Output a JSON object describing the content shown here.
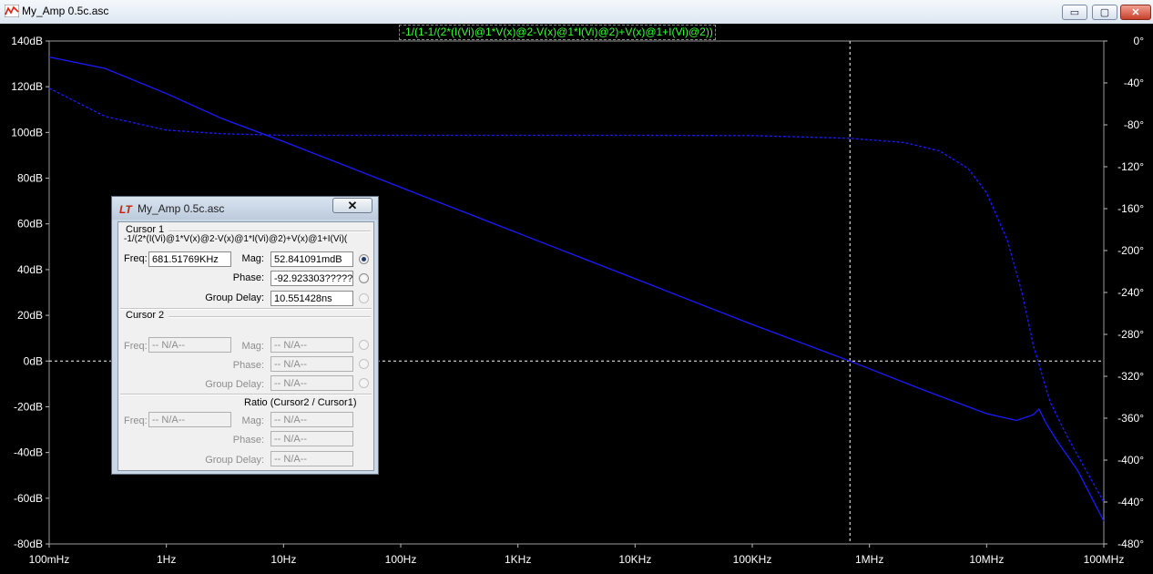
{
  "window": {
    "title": "My_Amp 0.5c.asc",
    "controls": {
      "minimize": "▭",
      "maximize": "▢",
      "close": "✕"
    }
  },
  "plot": {
    "trace_label": "-1/(1-1/(2*(I(Vi)@1*V(x)@2-V(x)@1*I(Vi)@2)+V(x)@1+I(Vi)@2))",
    "colors": {
      "background": "#000000",
      "trace": "#1a1aff",
      "axis_text": "#ffffff",
      "grid": "#ffffff",
      "label": "#33ff33"
    }
  },
  "chart_data": {
    "type": "line",
    "title": "",
    "x_scale": "log",
    "xlim": [
      0.1,
      100000000
    ],
    "x_ticks": [
      "100mHz",
      "1Hz",
      "10Hz",
      "100Hz",
      "1KHz",
      "10KHz",
      "100KHz",
      "1MHz",
      "10MHz",
      "100MHz"
    ],
    "ylim_left": [
      -80,
      140
    ],
    "y_ticks_left": [
      "140dB",
      "120dB",
      "100dB",
      "80dB",
      "60dB",
      "40dB",
      "20dB",
      "0dB",
      "-20dB",
      "-40dB",
      "-60dB",
      "-80dB"
    ],
    "ylim_right": [
      -480,
      0
    ],
    "y_ticks_right": [
      "0°",
      "-40°",
      "-80°",
      "-120°",
      "-160°",
      "-200°",
      "-240°",
      "-280°",
      "-320°",
      "-360°",
      "-400°",
      "-440°",
      "-480°"
    ],
    "series": [
      {
        "style": "solid",
        "axis": "left",
        "x": [
          0.1,
          0.3,
          1,
          3,
          10,
          100,
          1000,
          10000,
          100000,
          681517.69,
          3000000,
          10000000,
          18000000,
          25000000,
          28000000,
          32000000,
          40000000,
          60000000,
          100000000
        ],
        "y": [
          133,
          128,
          117,
          106,
          96,
          76,
          56,
          36,
          16,
          0,
          -13,
          -23,
          -26,
          -23.5,
          -21,
          -27,
          -35,
          -48,
          -70
        ]
      },
      {
        "style": "dashed",
        "axis": "right",
        "x": [
          0.1,
          0.3,
          1,
          3,
          10,
          100,
          1000,
          10000,
          100000,
          681517.69,
          2000000,
          4000000,
          7000000,
          10000000,
          15000000,
          20000000,
          25000000,
          30000000,
          35000000,
          50000000,
          100000000
        ],
        "y": [
          -45,
          -72,
          -85,
          -88.5,
          -90,
          -90,
          -90,
          -90,
          -90.3,
          -92.9,
          -97,
          -105,
          -122,
          -145,
          -190,
          -240,
          -290,
          -320,
          -345,
          -380,
          -440
        ]
      }
    ],
    "cursor": {
      "x": 681517.69,
      "y": 0
    }
  },
  "cursor_dialog": {
    "title": "My_Amp 0.5c.asc",
    "close_label": "✕",
    "cursor1": {
      "header": "Cursor 1",
      "expression": "-1/(2*(I(Vi)@1*V(x)@2-V(x)@1*I(Vi)@2)+V(x)@1+I(Vi)(",
      "freq_label": "Freq:",
      "freq": "681.51769KHz",
      "mag_label": "Mag:",
      "mag": "52.841091mdB",
      "phase_label": "Phase:",
      "phase": "-92.923303?????",
      "group_delay_label": "Group Delay:",
      "group_delay": "10.551428ns"
    },
    "cursor2": {
      "header": "Cursor 2",
      "freq_label": "Freq:",
      "freq": "-- N/A--",
      "mag_label": "Mag:",
      "mag": "-- N/A--",
      "phase_label": "Phase:",
      "phase": "-- N/A--",
      "group_delay_label": "Group Delay:",
      "group_delay": "-- N/A--"
    },
    "ratio": {
      "header": "Ratio (Cursor2 / Cursor1)",
      "freq_label": "Freq:",
      "freq": "-- N/A--",
      "mag_label": "Mag:",
      "mag": "-- N/A--",
      "phase_label": "Phase:",
      "phase": "-- N/A--",
      "group_delay_label": "Group Delay:",
      "group_delay": "-- N/A--"
    }
  }
}
